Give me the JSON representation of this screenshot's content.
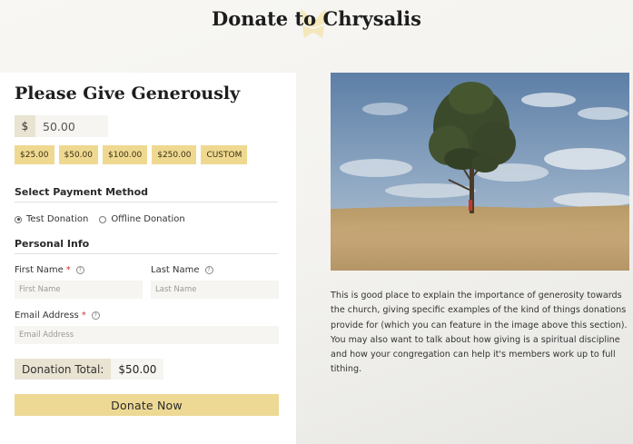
{
  "page": {
    "title": "Donate to Chrysalis"
  },
  "form": {
    "heading": "Please Give Generously",
    "currency_symbol": "$",
    "amount_value": "50.00",
    "presets": [
      "$25.00",
      "$50.00",
      "$100.00",
      "$250.00",
      "CUSTOM"
    ],
    "payment_section": {
      "heading": "Select Payment Method",
      "options": [
        {
          "label": "Test Donation",
          "selected": true
        },
        {
          "label": "Offline Donation",
          "selected": false
        }
      ]
    },
    "personal_section": {
      "heading": "Personal Info",
      "first_name": {
        "label": "First Name",
        "required_mark": "*",
        "placeholder": "First Name",
        "value": ""
      },
      "last_name": {
        "label": "Last Name",
        "placeholder": "Last Name",
        "value": ""
      },
      "email": {
        "label": "Email Address",
        "required_mark": "*",
        "placeholder": "Email Address",
        "value": ""
      },
      "help_glyph": "?"
    },
    "total": {
      "label": "Donation Total:",
      "value": "$50.00"
    },
    "submit_label": "Donate Now"
  },
  "aside": {
    "description": "This is good place to explain the importance of generosity towards the church, giving specific examples of the kind of things donations provide for (which you can feature in the image above this section). You may also want to talk about how giving is a spiritual discipline and how your congregation can help it's members work up to full tithing."
  },
  "colors": {
    "accent": "#efd991",
    "total_label_bg": "#e9e3d2",
    "input_bg": "#f6f5f1",
    "required": "#c0392b"
  }
}
